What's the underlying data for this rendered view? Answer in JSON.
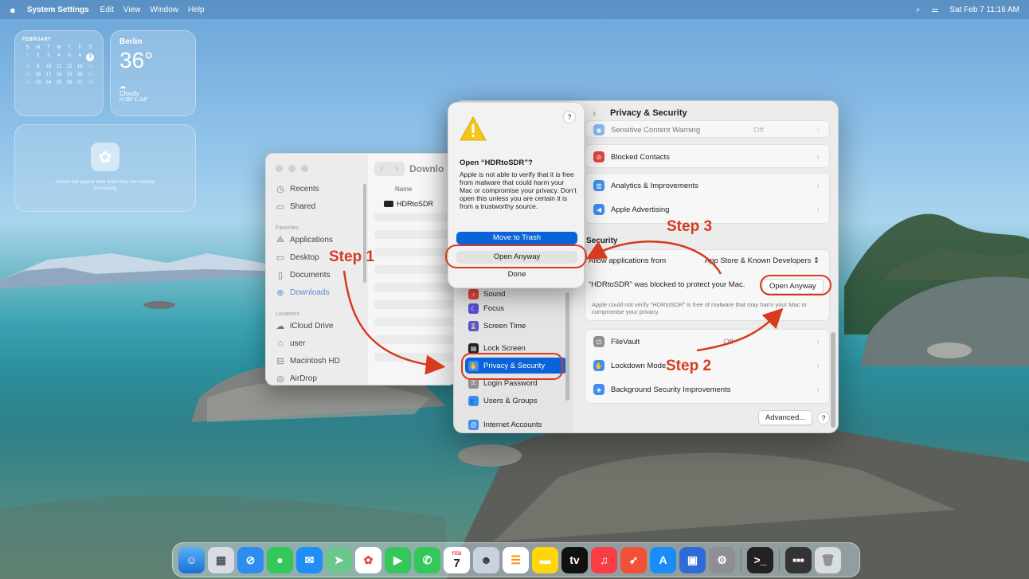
{
  "menubar": {
    "apple": "",
    "app_name": "System Settings",
    "menus": [
      "Edit",
      "View",
      "Window",
      "Help"
    ],
    "datetime": "Sat Feb 7  11:16 AM"
  },
  "widgets": {
    "calendar": {
      "month": "FEBRUARY",
      "weekdays": [
        "S",
        "M",
        "T",
        "W",
        "T",
        "F",
        "S"
      ],
      "weeks": [
        [
          "1",
          "2",
          "3",
          "4",
          "5",
          "6",
          "7"
        ],
        [
          "8",
          "9",
          "10",
          "11",
          "12",
          "13",
          "14"
        ],
        [
          "15",
          "16",
          "17",
          "18",
          "19",
          "20",
          "21"
        ],
        [
          "22",
          "23",
          "24",
          "25",
          "26",
          "27",
          "28"
        ]
      ],
      "today": "7"
    },
    "weather": {
      "city": "Berlin",
      "temp": "36°",
      "condition": "Cloudy",
      "hilo": "H:38° L:34°"
    },
    "photos": {
      "message": "Photos will appear here when they are finished processing"
    }
  },
  "finder": {
    "title": "Downlo",
    "column_name": "Name",
    "file": "HDRtoSDR",
    "sidebar": {
      "recents": "Recents",
      "shared": "Shared",
      "favorites_head": "Favorites",
      "applications": "Applications",
      "desktop": "Desktop",
      "documents": "Documents",
      "downloads": "Downloads",
      "locations_head": "Locations",
      "icloud": "iCloud Drive",
      "user": "user",
      "macintosh": "Macintosh HD",
      "airdrop": "AirDrop"
    }
  },
  "settings": {
    "title": "Privacy & Security",
    "sidebar": {
      "sound": "Sound",
      "focus": "Focus",
      "screen_time": "Screen Time",
      "lock_screen": "Lock Screen",
      "privacy": "Privacy & Security",
      "login_password": "Login Password",
      "users_groups": "Users & Groups",
      "internet_accounts": "Internet Accounts"
    },
    "rows": {
      "sensitive": "Sensitive Content Warning",
      "sensitive_val": "Off",
      "blocked": "Blocked Contacts",
      "analytics": "Analytics & Improvements",
      "advertising": "Apple Advertising",
      "security_head": "Security",
      "allow_label": "Allow applications from",
      "allow_value": "App Store & Known Developers",
      "blocked_msg": "“HDRtoSDR” was blocked to protect your Mac.",
      "open_anyway": "Open Anyway",
      "note": "Apple could not verify “HDRtoSDR” is free of malware that may harm your Mac or compromise your privacy.",
      "filevault": "FileVault",
      "filevault_val": "Off",
      "lockdown": "Lockdown Mode",
      "bg_security": "Background Security Improvements",
      "advanced": "Advanced...",
      "help": "?"
    }
  },
  "alert": {
    "title": "Open “HDRtoSDR”?",
    "body": "Apple is not able to verify that it is free from malware that could harm your Mac or compromise your privacy. Don’t open this unless you are certain it is from a trustworthy source.",
    "move_to_trash": "Move to Trash",
    "open_anyway": "Open Anyway",
    "done": "Done",
    "help": "?"
  },
  "annotations": {
    "step1": "Step 1",
    "step2": "Step 2",
    "step3": "Step 3"
  },
  "dock": {
    "calendar_month": "FEB",
    "calendar_day": "7",
    "tv": "tv"
  },
  "colors": {
    "accent": "#0a64d8",
    "annotation": "#d63a1f"
  }
}
